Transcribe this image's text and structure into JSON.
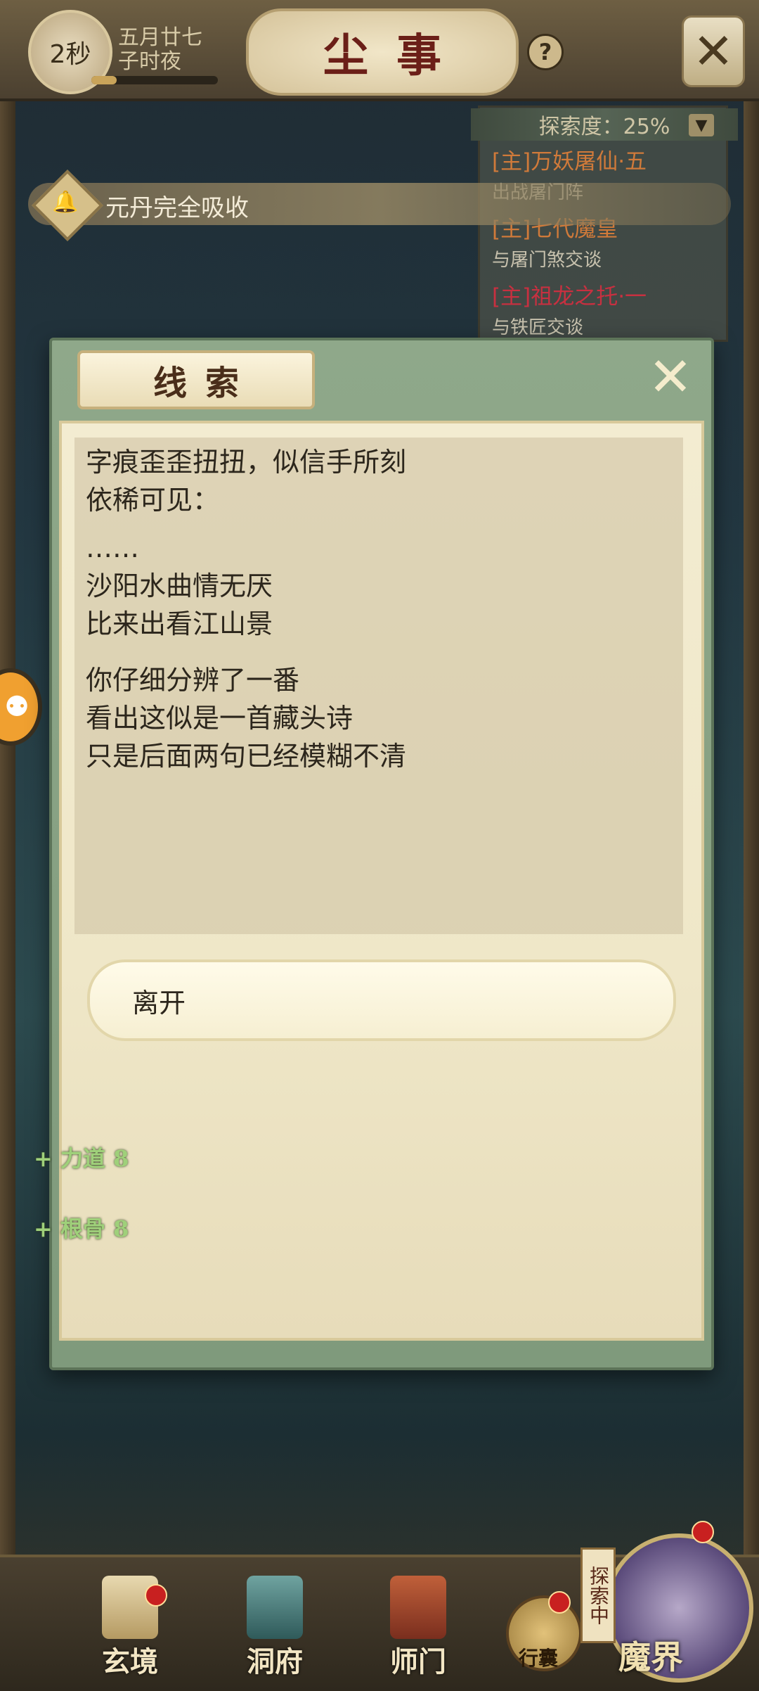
{
  "topbar": {
    "timer": "2秒",
    "date_line1": "五月廿七",
    "date_line2": "子时夜",
    "timer_progress": 0.2,
    "title": "尘事",
    "help_label": "?",
    "close_label": "✕"
  },
  "quests": {
    "header": "探索度：25%",
    "items": [
      {
        "title": "[主]万妖屠仙·五",
        "subtitle": "出战屠门阵",
        "color": "#d07a3a"
      },
      {
        "title": "[主]七代魔皇",
        "subtitle": "与屠门煞交谈",
        "color": "#d07a3a"
      },
      {
        "title": "[主]祖龙之托·一",
        "subtitle": "与铁匠交谈",
        "color": "#c83040"
      }
    ]
  },
  "banner": {
    "text": "元丹完全吸收",
    "icon": "bell-icon"
  },
  "modal": {
    "title": "线索",
    "close_label": "✕",
    "paragraphs": [
      [
        "字痕歪歪扭扭，似信手所刻",
        "依稀可见："
      ],
      [
        "……",
        "沙阳水曲情无厌",
        "比来出看江山景"
      ],
      [
        "你仔细分辨了一番",
        "看出这似是一首藏头诗",
        "只是后面两句已经模糊不清"
      ]
    ],
    "leave_button": "离开"
  },
  "stats": [
    {
      "label": "+ 力道 8"
    },
    {
      "label": "+ 根骨 8"
    }
  ],
  "bottom_nav": {
    "items": [
      {
        "label": "玄境",
        "icon": "scroll-icon",
        "badge": true
      },
      {
        "label": "洞府",
        "icon": "pavilion-icon",
        "badge": false
      },
      {
        "label": "师门",
        "icon": "banner-icon",
        "badge": false
      }
    ],
    "bag_label": "行囊",
    "explore_tag": "探索中",
    "realm_label": "魔界"
  }
}
